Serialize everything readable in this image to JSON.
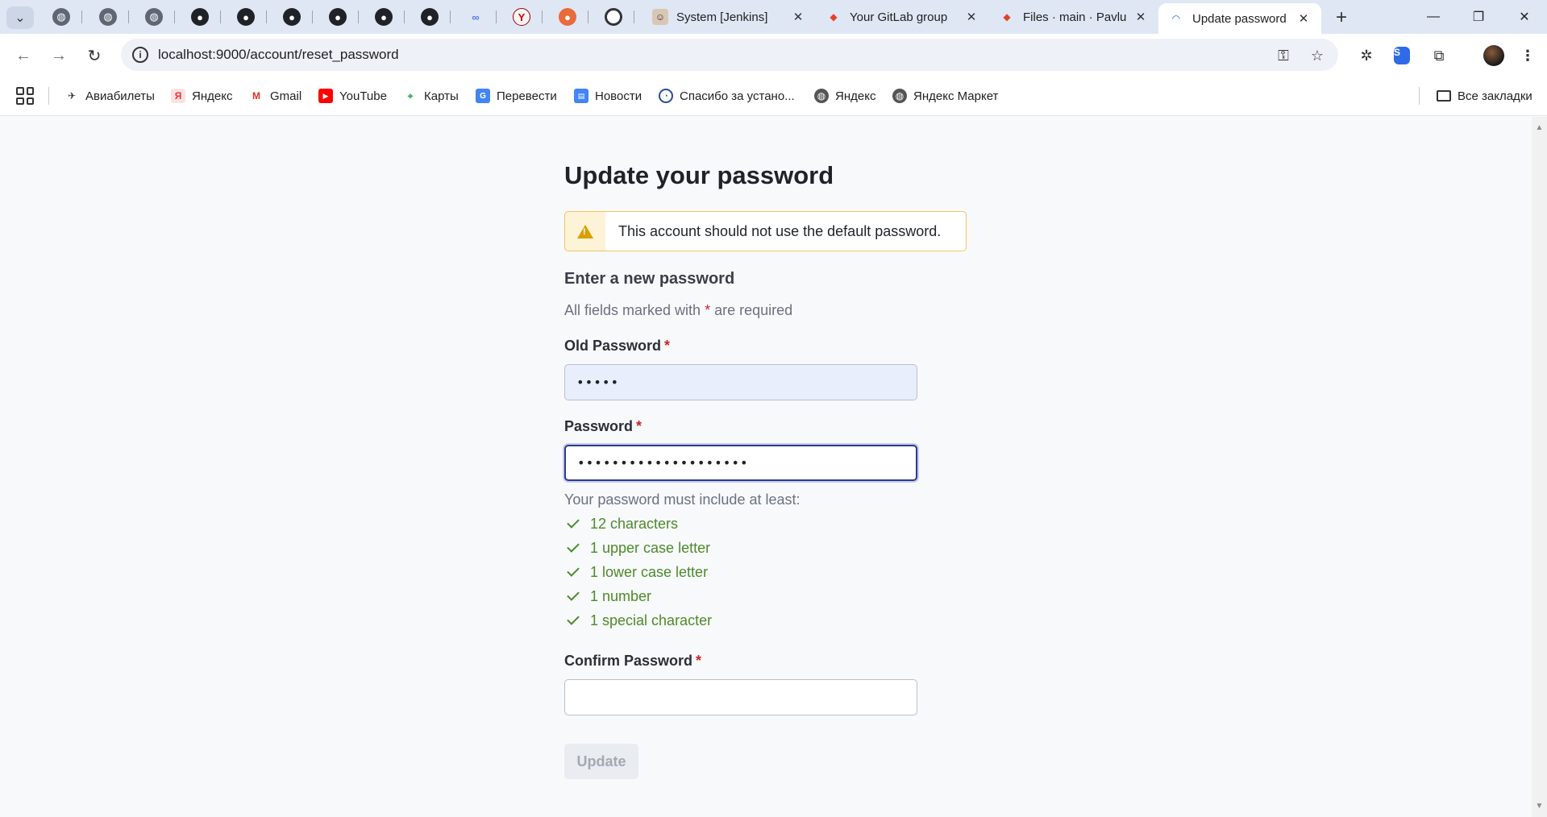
{
  "browser": {
    "tabs": [
      {
        "title": "System [Jenkins]",
        "favicon": "jenkins-icon"
      },
      {
        "title": "Your GitLab group",
        "favicon": "gitlab-icon"
      },
      {
        "title": "Files · main · Pavlu",
        "favicon": "gitlab-icon"
      },
      {
        "title": "Update password",
        "favicon": "sonarqube-icon",
        "active": true
      }
    ],
    "pinned_tabs": [
      "globe-icon",
      "globe-icon",
      "globe-icon",
      "github-icon",
      "github-icon",
      "github-icon",
      "github-icon",
      "github-icon",
      "github-icon",
      "tab-icon-blue",
      "tab-icon-y",
      "tab-icon-orange",
      "tab-icon-target"
    ],
    "url": "localhost:9000/account/reset_password",
    "bookmarks": [
      {
        "label": "Авиабилеты",
        "icon": "plane-icon"
      },
      {
        "label": "Яндекс",
        "icon": "yandex-icon"
      },
      {
        "label": "Gmail",
        "icon": "gmail-icon"
      },
      {
        "label": "YouTube",
        "icon": "youtube-icon"
      },
      {
        "label": "Карты",
        "icon": "maps-icon"
      },
      {
        "label": "Перевести",
        "icon": "translate-icon"
      },
      {
        "label": "Новости",
        "icon": "news-icon"
      },
      {
        "label": "Спасибо за устано...",
        "icon": "app-icon"
      },
      {
        "label": "Яндекс",
        "icon": "globe-icon"
      },
      {
        "label": "Яндекс Маркет",
        "icon": "globe-icon"
      }
    ],
    "all_bookmarks": "Все закладки"
  },
  "page": {
    "title": "Update your password",
    "alert": "This account should not use the default password.",
    "section_title": "Enter a new password",
    "required_note_pre": "All fields marked with",
    "required_star": "*",
    "required_note_post": "are required",
    "fields": {
      "old_password": {
        "label": "Old Password",
        "value": "•••••"
      },
      "password": {
        "label": "Password",
        "value": "••••••••••••••••••••"
      },
      "confirm_password": {
        "label": "Confirm Password",
        "value": ""
      }
    },
    "rules_intro": "Your password must include at least:",
    "rules": [
      "12 characters",
      "1 upper case letter",
      "1 lower case letter",
      "1 number",
      "1 special character"
    ],
    "submit_label": "Update"
  },
  "colors": {
    "rule_ok": "#4d8a2a",
    "required_star": "#c62828",
    "alert_border": "#f0c560",
    "focus_border": "#2c3a8c"
  }
}
